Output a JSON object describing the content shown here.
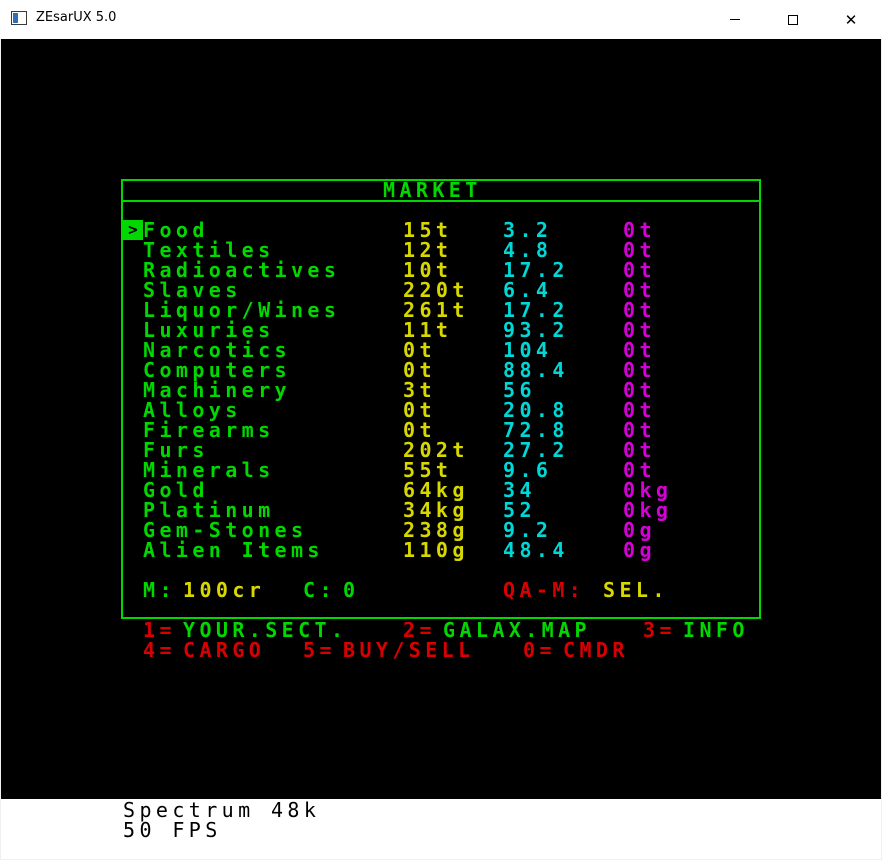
{
  "window": {
    "title": "ZEsarUX 5.0",
    "minimize_glyph": "",
    "close_glyph": "✕"
  },
  "market": {
    "title": "MARKET",
    "cursor": ">",
    "items": [
      {
        "name": "Food",
        "qty": "15t",
        "price": "3.2",
        "hold": "0t"
      },
      {
        "name": "Textiles",
        "qty": "12t",
        "price": "4.8",
        "hold": "0t"
      },
      {
        "name": "Radioactives",
        "qty": "10t",
        "price": "17.2",
        "hold": "0t"
      },
      {
        "name": "Slaves",
        "qty": "220t",
        "price": "6.4",
        "hold": "0t"
      },
      {
        "name": "Liquor/Wines",
        "qty": "261t",
        "price": "17.2",
        "hold": "0t"
      },
      {
        "name": "Luxuries",
        "qty": "11t",
        "price": "93.2",
        "hold": "0t"
      },
      {
        "name": "Narcotics",
        "qty": "0t",
        "price": "104",
        "hold": "0t"
      },
      {
        "name": "Computers",
        "qty": "0t",
        "price": "88.4",
        "hold": "0t"
      },
      {
        "name": "Machinery",
        "qty": "3t",
        "price": "56",
        "hold": "0t"
      },
      {
        "name": "Alloys",
        "qty": "0t",
        "price": "20.8",
        "hold": "0t"
      },
      {
        "name": "Firearms",
        "qty": "0t",
        "price": "72.8",
        "hold": "0t"
      },
      {
        "name": "Furs",
        "qty": "202t",
        "price": "27.2",
        "hold": "0t"
      },
      {
        "name": "Minerals",
        "qty": "55t",
        "price": "9.6",
        "hold": "0t"
      },
      {
        "name": "Gold",
        "qty": "64kg",
        "price": "34",
        "hold": "0kg"
      },
      {
        "name": "Platinum",
        "qty": "34kg",
        "price": "52",
        "hold": "0kg"
      },
      {
        "name": "Gem-Stones",
        "qty": "238g",
        "price": "9.2",
        "hold": "0g"
      },
      {
        "name": "Alien Items",
        "qty": "110g",
        "price": "48.4",
        "hold": "0g"
      }
    ],
    "money_label": "M:",
    "money_value": "100cr",
    "cargo_label": "C:",
    "cargo_value": "0",
    "keys_label": "QA-M:",
    "keys_action": "SEL."
  },
  "menu": [
    {
      "key": "1=",
      "label": "YOUR.SECT."
    },
    {
      "key": "2=",
      "label": "GALAX.MAP"
    },
    {
      "key": "3=",
      "label": "INFO"
    },
    {
      "key": "4=",
      "label": "CARGO"
    },
    {
      "key": "5=",
      "label": "BUY/SELL"
    },
    {
      "key": "0=",
      "label": "CMDR"
    }
  ],
  "status": {
    "machine": "Spectrum 48k",
    "fps": "50 FPS"
  },
  "colors": {
    "green": "#00d800",
    "yellow": "#d8d800",
    "cyan": "#00d8d8",
    "magenta": "#d800d8",
    "red": "#d80000"
  }
}
